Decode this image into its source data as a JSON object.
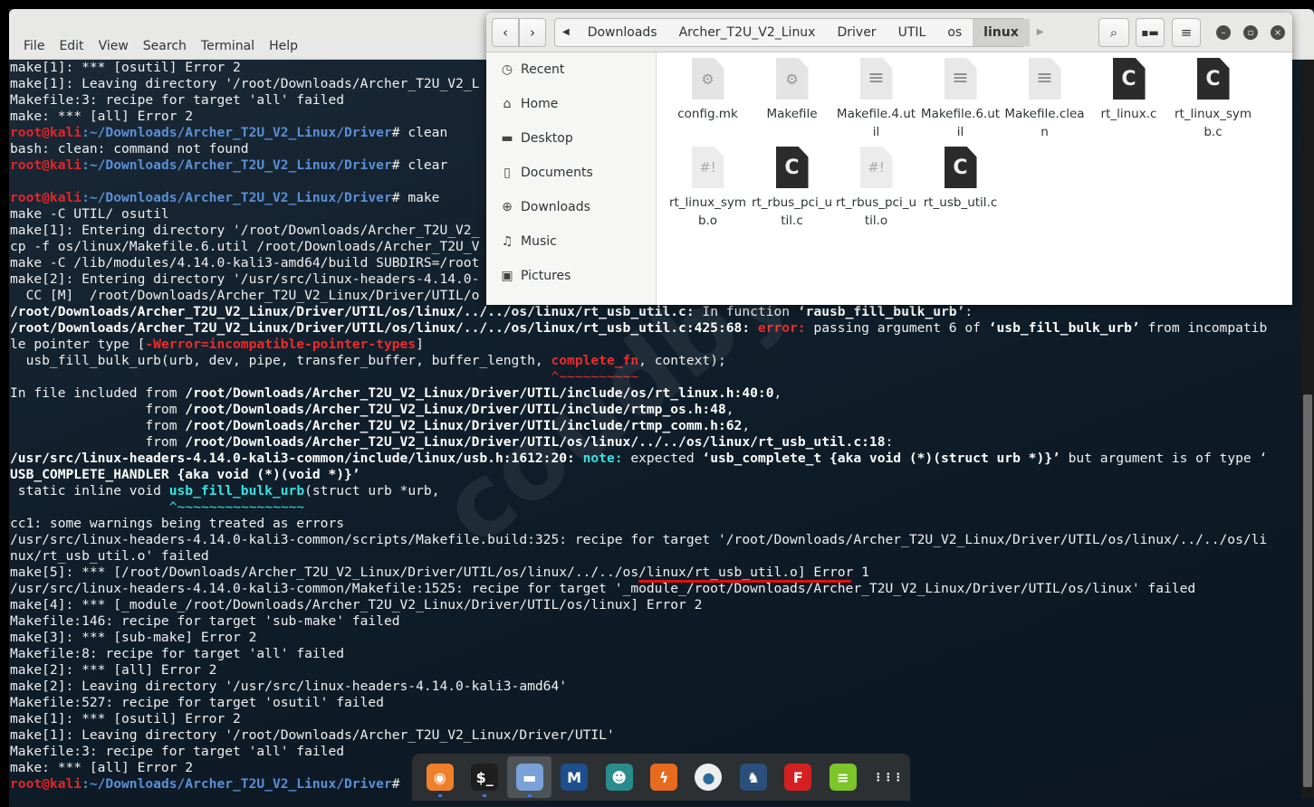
{
  "terminal": {
    "menu": [
      "File",
      "Edit",
      "View",
      "Search",
      "Terminal",
      "Help"
    ],
    "lines": [
      [
        [
          "make[1]: *** [osutil] Error 2",
          "n"
        ]
      ],
      [
        [
          "make[1]: Leaving directory '/root/Downloads/Archer_T2U_V2_L",
          "n"
        ]
      ],
      [
        [
          "Makefile:3: recipe for target 'all' failed",
          "n"
        ]
      ],
      [
        [
          "make: *** [all] Error 2",
          "n"
        ]
      ],
      [
        [
          "root@kali",
          "u"
        ],
        [
          ":~/Downloads/Archer_T2U_V2_Linux/Driver",
          "p"
        ],
        [
          "# clean",
          "n"
        ]
      ],
      [
        [
          "bash: clean: command not found",
          "n"
        ]
      ],
      [
        [
          "root@kali",
          "u"
        ],
        [
          ":~/Downloads/Archer_T2U_V2_Linux/Driver",
          "p"
        ],
        [
          "# clear",
          "n"
        ]
      ],
      [],
      [
        [
          "root@kali",
          "u"
        ],
        [
          ":~/Downloads/Archer_T2U_V2_Linux/Driver",
          "p"
        ],
        [
          "# make",
          "n"
        ]
      ],
      [
        [
          "make -C UTIL/ osutil",
          "n"
        ]
      ],
      [
        [
          "make[1]: Entering directory '/root/Downloads/Archer_T2U_V2_",
          "n"
        ]
      ],
      [
        [
          "cp -f os/linux/Makefile.6.util /root/Downloads/Archer_T2U_V",
          "n"
        ]
      ],
      [
        [
          "make -C /lib/modules/4.14.0-kali3-amd64/build SUBDIRS=/root",
          "n"
        ]
      ],
      [
        [
          "make[2]: Entering directory '/usr/src/linux-headers-4.14.0-",
          "n"
        ]
      ],
      [
        [
          "  CC [M]  /root/Downloads/Archer_T2U_V2_Linux/Driver/UTIL/o",
          "n"
        ]
      ],
      [
        [
          "/root/Downloads/Archer_T2U_V2_Linux/Driver/UTIL/os/linux/../../os/linux/rt_usb_util.c:",
          "b"
        ],
        [
          " In function ",
          "n"
        ],
        [
          "‘rausb_fill_bulk_urb’",
          "b"
        ],
        [
          ":",
          "n"
        ]
      ],
      [
        [
          "/root/Downloads/Archer_T2U_V2_Linux/Driver/UTIL/os/linux/../../os/linux/rt_usb_util.c:425:68:",
          "b"
        ],
        [
          " error:",
          "e"
        ],
        [
          " passing argument 6 of ",
          "n"
        ],
        [
          "‘usb_fill_bulk_urb’",
          "b"
        ],
        [
          " from incompatib",
          "n"
        ]
      ],
      [
        [
          "le pointer type [",
          "n"
        ],
        [
          "-Werror=incompatible-pointer-types",
          "e"
        ],
        [
          "]",
          "n"
        ]
      ],
      [
        [
          "  usb_fill_bulk_urb(urb, dev, pipe, transfer_buffer, buffer_length, ",
          "n"
        ],
        [
          "complete_fn",
          "e"
        ],
        [
          ", context);",
          "n"
        ]
      ],
      [
        [
          "                                                                    ^~~~~~~~~~~",
          "er"
        ]
      ],
      [
        [
          "In file included from ",
          "n"
        ],
        [
          "/root/Downloads/Archer_T2U_V2_Linux/Driver/UTIL/include/os/rt_linux.h:40:0",
          "b"
        ],
        [
          ",",
          "n"
        ]
      ],
      [
        [
          "                 from ",
          "n"
        ],
        [
          "/root/Downloads/Archer_T2U_V2_Linux/Driver/UTIL/include/rtmp_os.h:48",
          "b"
        ],
        [
          ",",
          "n"
        ]
      ],
      [
        [
          "                 from ",
          "n"
        ],
        [
          "/root/Downloads/Archer_T2U_V2_Linux/Driver/UTIL/include/rtmp_comm.h:62",
          "b"
        ],
        [
          ",",
          "n"
        ]
      ],
      [
        [
          "                 from ",
          "n"
        ],
        [
          "/root/Downloads/Archer_T2U_V2_Linux/Driver/UTIL/os/linux/../../os/linux/rt_usb_util.c:18",
          "b"
        ],
        [
          ":",
          "n"
        ]
      ],
      [
        [
          "/usr/src/linux-headers-4.14.0-kali3-common/include/linux/usb.h:1612:20:",
          "b"
        ],
        [
          " note:",
          "c"
        ],
        [
          " expected ",
          "n"
        ],
        [
          "‘usb_complete_t {aka void (*)(struct urb *)}’",
          "b"
        ],
        [
          " but argument is of type ‘",
          "n"
        ]
      ],
      [
        [
          "USB_COMPLETE_HANDLER {aka void (*)(void *)}’",
          "b"
        ]
      ],
      [
        [
          " static inline void ",
          "n"
        ],
        [
          "usb_fill_bulk_urb",
          "c"
        ],
        [
          "(struct urb *urb,",
          "n"
        ]
      ],
      [
        [
          "                    ^~~~~~~~~~~~~~~~~",
          "cn"
        ]
      ],
      [
        [
          "cc1: some warnings being treated as errors",
          "n"
        ]
      ],
      [
        [
          "/usr/src/linux-headers-4.14.0-kali3-common/scripts/Makefile.build:325: recipe for target '/root/Downloads/Archer_T2U_V2_Linux/Driver/UTIL/os/linux/../../os/li",
          "n"
        ]
      ],
      [
        [
          "nux/rt_usb_util.o' failed",
          "n"
        ]
      ],
      [
        [
          "make[5]: *** [/root/Downloads/Archer_T2U_V2_Linux/Driver/UTIL/os/linux/../../os/linux/rt_usb_util.o] Error 1",
          "n"
        ]
      ],
      [
        [
          "/usr/src/linux-headers-4.14.0-kali3-common/Makefile:1525: recipe for target '_module_/root/Downloads/Archer_T2U_V2_Linux/Driver/UTIL/os/linux' failed",
          "n"
        ]
      ],
      [
        [
          "make[4]: *** [_module_/root/Downloads/Archer_T2U_V2_Linux/Driver/UTIL/os/linux] Error 2",
          "n"
        ]
      ],
      [
        [
          "Makefile:146: recipe for target 'sub-make' failed",
          "n"
        ]
      ],
      [
        [
          "make[3]: *** [sub-make] Error 2",
          "n"
        ]
      ],
      [
        [
          "Makefile:8: recipe for target 'all' failed",
          "n"
        ]
      ],
      [
        [
          "make[2]: *** [all] Error 2",
          "n"
        ]
      ],
      [
        [
          "make[2]: Leaving directory '/usr/src/linux-headers-4.14.0-kali3-amd64'",
          "n"
        ]
      ],
      [
        [
          "Makefile:527: recipe for target 'osutil' failed",
          "n"
        ]
      ],
      [
        [
          "make[1]: *** [osutil] Error 2",
          "n"
        ]
      ],
      [
        [
          "make[1]: Leaving directory '/root/Downloads/Archer_T2U_V2_Linux/Driver/UTIL'",
          "n"
        ]
      ],
      [
        [
          "Makefile:3: recipe for target 'all' failed",
          "n"
        ]
      ],
      [
        [
          "make: *** [all] Error 2",
          "n"
        ]
      ],
      [
        [
          "root@kali",
          "u"
        ],
        [
          ":~/Downloads/Archer_T2U_V2_Linux/Driver",
          "p"
        ],
        [
          "# ",
          "n"
        ]
      ]
    ],
    "watermark": "coudbyinet"
  },
  "file_manager": {
    "path": [
      "Downloads",
      "Archer_T2U_V2_Linux",
      "Driver",
      "UTIL",
      "os",
      "linux"
    ],
    "sidebar": [
      {
        "label": "Recent",
        "icon": "clock-icon"
      },
      {
        "label": "Home",
        "icon": "home-icon"
      },
      {
        "label": "Desktop",
        "icon": "desktop-icon"
      },
      {
        "label": "Documents",
        "icon": "document-icon"
      },
      {
        "label": "Downloads",
        "icon": "download-icon"
      },
      {
        "label": "Music",
        "icon": "music-icon"
      },
      {
        "label": "Pictures",
        "icon": "pictures-icon"
      }
    ],
    "files": [
      {
        "name": "config.mk",
        "type": "gear"
      },
      {
        "name": "Makefile",
        "type": "gear"
      },
      {
        "name": "Makefile.4.util",
        "type": "text"
      },
      {
        "name": "Makefile.6.util",
        "type": "text"
      },
      {
        "name": "Makefile.clean",
        "type": "text"
      },
      {
        "name": "rt_linux.c",
        "type": "c"
      },
      {
        "name": "rt_linux_symb.c",
        "type": "c"
      },
      {
        "name": "rt_linux_symb.o",
        "type": "script"
      },
      {
        "name": "rt_rbus_pci_util.c",
        "type": "c"
      },
      {
        "name": "rt_rbus_pci_util.o",
        "type": "script"
      },
      {
        "name": "rt_usb_util.c",
        "type": "c"
      }
    ]
  },
  "dock": [
    {
      "name": "firefox",
      "color": "#f07f2a",
      "glyph": "◉",
      "active": true
    },
    {
      "name": "terminal",
      "color": "#1e1e1e",
      "glyph": "$_",
      "active": true
    },
    {
      "name": "files",
      "color": "#7aa1d8",
      "glyph": "▬",
      "active": true,
      "selected": true
    },
    {
      "name": "metasploit",
      "color": "#1c4f8c",
      "glyph": "M"
    },
    {
      "name": "armitage",
      "color": "#2a8c8c",
      "glyph": "☻"
    },
    {
      "name": "burpsuite",
      "color": "#e66b1f",
      "glyph": "ϟ"
    },
    {
      "name": "maltego",
      "color": "#eeeeee",
      "glyph": "●"
    },
    {
      "name": "beef",
      "color": "#2a4f7a",
      "glyph": "♞"
    },
    {
      "name": "faraday",
      "color": "#d42020",
      "glyph": "F"
    },
    {
      "name": "notes",
      "color": "#7cc52a",
      "glyph": "≡"
    },
    {
      "name": "show-apps",
      "color": "transparent",
      "glyph": "⋮⋮⋮"
    }
  ]
}
